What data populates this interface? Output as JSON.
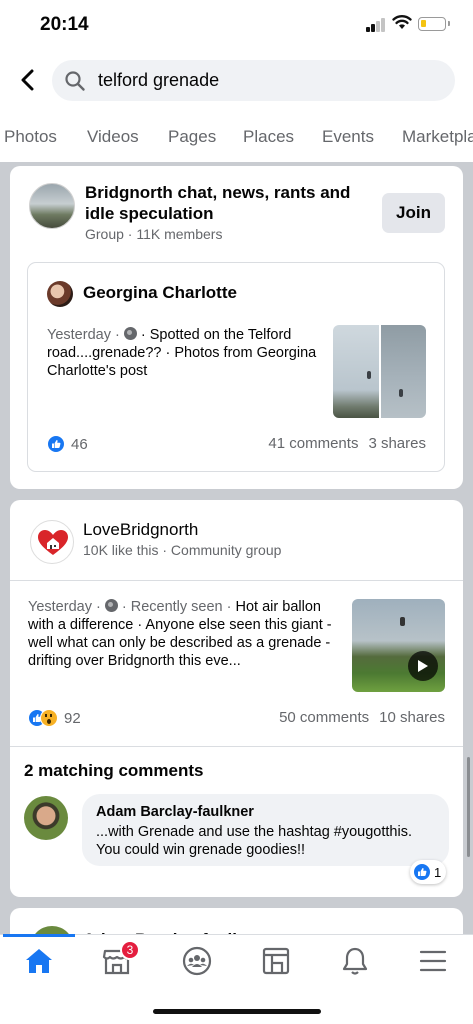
{
  "status_bar": {
    "time": "20:14"
  },
  "search": {
    "query": "telford grenade"
  },
  "tabs": [
    "Photos",
    "Videos",
    "Pages",
    "Places",
    "Events",
    "Marketpla"
  ],
  "group_result": {
    "name": "Bridgnorth chat, news, rants and idle speculation",
    "meta": "Group · 11K members",
    "join_label": "Join",
    "post": {
      "author": "Georgina Charlotte",
      "time": "Yesterday ·",
      "text": "· Spotted on the Telford road....grenade?? · Photos from Georgina Charlotte's post",
      "likes": "46",
      "comments": "41 comments",
      "shares": "3 shares"
    }
  },
  "page_result": {
    "name": "LoveBridgnorth",
    "meta": "10K like this · Community group",
    "post": {
      "time": "Yesterday ·",
      "tag": "· Recently seen ·",
      "text": "Hot air ballon with a difference · Anyone else seen this giant - well what can only be described as a grenade - drifting over Bridgnorth this eve...",
      "reactions": "92",
      "comments": "50 comments",
      "shares": "10 shares"
    },
    "matching_comments_title": "2 matching comments",
    "comment": {
      "author": "Adam Barclay-faulkner",
      "text": "...with Grenade and use the hashtag #yougotthis. You could win grenade goodies!!",
      "likes": "1"
    }
  },
  "partial_result": {
    "name": "Adam Barclay-faulkner"
  },
  "bottom_nav": {
    "marketplace_badge": "3"
  },
  "colors": {
    "accent": "#1877f2",
    "badge": "#e41e3f",
    "feed_bg": "#c9ccd1"
  }
}
